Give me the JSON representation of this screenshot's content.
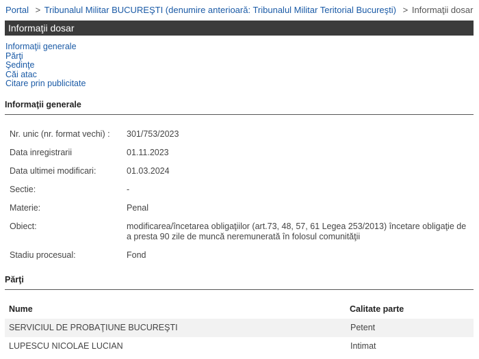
{
  "breadcrumb": {
    "portal": "Portal",
    "court": "Tribunalul Militar BUCUREŞTI (denumire anterioară: Tribunalul Militar Teritorial Bucureşti)",
    "current": "Informaţii dosar",
    "separator": ">"
  },
  "title": "Informaţii dosar",
  "nav": [
    "Informaţii generale",
    "Părţi",
    "Şedinţe",
    "Căi atac",
    "Citare prin publicitate"
  ],
  "general": {
    "heading": "Informaţii generale",
    "rows": [
      {
        "label": "Nr. unic (nr. format vechi) :",
        "value": "301/753/2023"
      },
      {
        "label": "Data inregistrarii",
        "value": "01.11.2023"
      },
      {
        "label": "Data ultimei modificari:",
        "value": "01.03.2024"
      },
      {
        "label": "Sectie:",
        "value": "-"
      },
      {
        "label": "Materie:",
        "value": "Penal"
      },
      {
        "label": "Obiect:",
        "value": "modificarea/încetarea obligaţiilor (art.73, 48, 57, 61 Legea 253/2013) încetare obligaţie de a presta 90 zile de muncă neremunerată în folosul comunităţii"
      },
      {
        "label": "Stadiu procesual:",
        "value": "Fond"
      }
    ]
  },
  "parties": {
    "heading": "Părţi",
    "columns": [
      "Nume",
      "Calitate parte"
    ],
    "rows": [
      {
        "name": "SERVICIUL DE PROBAŢIUNE BUCUREŞTI",
        "role": "Petent"
      },
      {
        "name": "LUPESCU NICOLAE LUCIAN",
        "role": "Intimat"
      }
    ]
  }
}
